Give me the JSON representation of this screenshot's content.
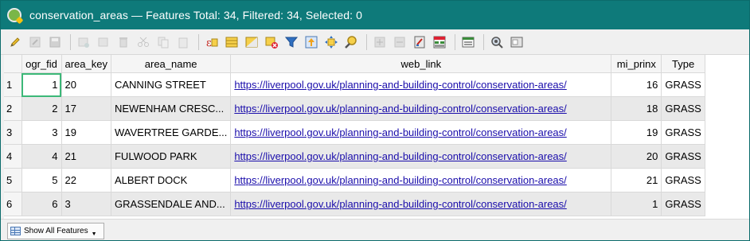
{
  "window": {
    "title": "conservation_areas — Features Total: 34, Filtered: 34, Selected: 0"
  },
  "toolbar": {
    "icons": [
      "toggle-editing-icon",
      "multi-edit-icon",
      "save-edits-icon",
      "reload-icon",
      "add-feature-icon",
      "delete-feature-icon",
      "cut-icon",
      "copy-icon",
      "paste-icon",
      "expression-select-icon",
      "select-all-icon",
      "invert-selection-icon",
      "deselect-all-icon",
      "filter-select-icon",
      "move-selection-top-icon",
      "pan-to-selection-icon",
      "zoom-to-selection-icon",
      "new-field-icon",
      "delete-field-icon",
      "field-calculator-icon",
      "conditional-format-icon",
      "dock-icon",
      "actions-icon",
      "dev-tools-icon"
    ]
  },
  "table": {
    "columns": [
      "ogr_fid",
      "area_key",
      "area_name",
      "web_link",
      "mi_prinx",
      "Type"
    ],
    "rows": [
      {
        "row_number": "1",
        "ogr_fid": "1",
        "area_key": "20",
        "area_name": "CANNING STREET",
        "web_link": "https://liverpool.gov.uk/planning-and-building-control/conservation-areas/",
        "mi_prinx": "16",
        "type": "GRASS"
      },
      {
        "row_number": "2",
        "ogr_fid": "2",
        "area_key": "17",
        "area_name": "NEWENHAM CRESC...",
        "web_link": "https://liverpool.gov.uk/planning-and-building-control/conservation-areas/",
        "mi_prinx": "18",
        "type": "GRASS"
      },
      {
        "row_number": "3",
        "ogr_fid": "3",
        "area_key": "19",
        "area_name": "WAVERTREE GARDE...",
        "web_link": "https://liverpool.gov.uk/planning-and-building-control/conservation-areas/",
        "mi_prinx": "19",
        "type": "GRASS"
      },
      {
        "row_number": "4",
        "ogr_fid": "4",
        "area_key": "21",
        "area_name": "FULWOOD PARK",
        "web_link": "https://liverpool.gov.uk/planning-and-building-control/conservation-areas/",
        "mi_prinx": "20",
        "type": "GRASS"
      },
      {
        "row_number": "5",
        "ogr_fid": "5",
        "area_key": "22",
        "area_name": "ALBERT DOCK",
        "web_link": "https://liverpool.gov.uk/planning-and-building-control/conservation-areas/",
        "mi_prinx": "21",
        "type": "GRASS"
      },
      {
        "row_number": "6",
        "ogr_fid": "6",
        "area_key": "3",
        "area_name": "GRASSENDALE AND...",
        "web_link": "https://liverpool.gov.uk/planning-and-building-control/conservation-areas/",
        "mi_prinx": "1",
        "type": "GRASS"
      }
    ]
  },
  "statusbar": {
    "show_features_label": "Show All Features"
  },
  "colors": {
    "titlebar": "#0e7a7a",
    "link": "#1a0dab",
    "selected_cell_border": "#3cb878"
  }
}
